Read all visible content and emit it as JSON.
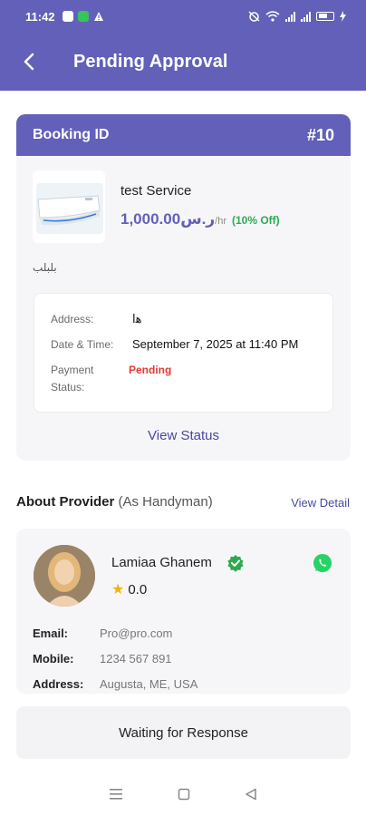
{
  "status_bar": {
    "time": "11:42"
  },
  "app_bar": {
    "title": "Pending Approval"
  },
  "booking": {
    "id_label": "Booking ID",
    "id_value": "#10",
    "service_name": "test Service",
    "price": "1,000.00ر.س",
    "per": "/hr",
    "discount": "(10% Off)",
    "arabic_text": "بلبلب",
    "details": {
      "address_label": "Address:",
      "address_value": "ﻫا",
      "datetime_label": "Date & Time:",
      "datetime_value": "September 7, 2025 at 11:40 PM",
      "payment_label_1": "Payment",
      "payment_label_2": "Status:",
      "payment_value": "Pending"
    },
    "view_status": "View Status"
  },
  "provider": {
    "section_title": "About Provider",
    "section_sub": "(As Handyman)",
    "view_detail": "View Detail",
    "name": "Lamiaa Ghanem",
    "rating": "0.0",
    "email_label": "Email:",
    "email_value": "Pro@pro.com",
    "mobile_label": "Mobile:",
    "mobile_value": "1234 567 891",
    "address_label": "Address:",
    "address_value": "Augusta, ME, USA"
  },
  "footer": {
    "waiting": "Waiting for Response"
  },
  "colors": {
    "primary": "#6360b9",
    "pending": "#e53935",
    "discount": "#2fa84f",
    "whatsapp": "#25d366",
    "star": "#f6b400"
  }
}
